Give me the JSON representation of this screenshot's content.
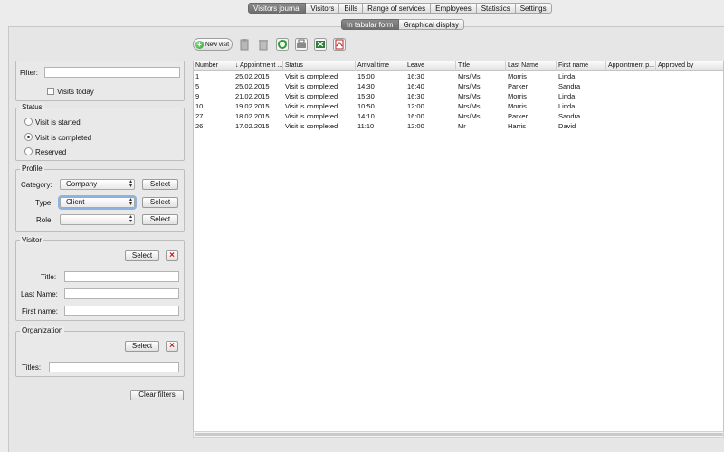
{
  "nav": {
    "tabs": [
      {
        "label": "Visitors journal",
        "active": true
      },
      {
        "label": "Visitors"
      },
      {
        "label": "Bills"
      },
      {
        "label": "Range of services"
      },
      {
        "label": "Employees"
      },
      {
        "label": "Statistics"
      },
      {
        "label": "Settings"
      }
    ]
  },
  "view_tabs": [
    {
      "label": "In tabular form",
      "active": true
    },
    {
      "label": "Graphical display"
    }
  ],
  "toolbar": {
    "new_visit_label": "New visit",
    "icons": [
      "new-visit-icon",
      "clipboard-icon",
      "trash-icon",
      "refresh-icon",
      "print-icon",
      "excel-export-icon",
      "pdf-export-icon"
    ]
  },
  "filter": {
    "label": "Filter:",
    "value": "",
    "visits_today_label": "Visits today",
    "visits_today_checked": false
  },
  "status": {
    "title": "Status",
    "options": [
      "Visit is started",
      "Visit is completed",
      "Reserved"
    ],
    "selected": "Visit is completed"
  },
  "profile": {
    "title": "Profile",
    "category_label": "Category:",
    "category_value": "Company",
    "type_label": "Type:",
    "type_value": "Client",
    "role_label": "Role:",
    "role_value": "",
    "select_label": "Select"
  },
  "visitor": {
    "title": "Visitor",
    "select_label": "Select",
    "title_label": "Title:",
    "last_name_label": "Last Name:",
    "first_name_label": "First name:"
  },
  "organization": {
    "title": "Organization",
    "select_label": "Select",
    "titles_label": "Titles:"
  },
  "clear_filters_label": "Clear filters",
  "table": {
    "columns": [
      "Number",
      "↓ Appointment ...",
      "Status",
      "Arrival time",
      "Leave",
      "Title",
      "Last Name",
      "First name",
      "Appointment p...",
      "Approved by"
    ],
    "rows": [
      [
        "1",
        "25.02.2015",
        "Visit is completed",
        "15:00",
        "16:30",
        "Mrs/Ms",
        "Morris",
        "Linda",
        "",
        ""
      ],
      [
        "5",
        "25.02.2015",
        "Visit is completed",
        "14:30",
        "16:40",
        "Mrs/Ms",
        "Parker",
        "Sandra",
        "",
        ""
      ],
      [
        "9",
        "21.02.2015",
        "Visit is completed",
        "15:30",
        "16:30",
        "Mrs/Ms",
        "Morris",
        "Linda",
        "",
        ""
      ],
      [
        "10",
        "19.02.2015",
        "Visit is completed",
        "10:50",
        "12:00",
        "Mrs/Ms",
        "Morris",
        "Linda",
        "",
        ""
      ],
      [
        "27",
        "18.02.2015",
        "Visit is completed",
        "14:10",
        "16:00",
        "Mrs/Ms",
        "Parker",
        "Sandra",
        "",
        ""
      ],
      [
        "26",
        "17.02.2015",
        "Visit is completed",
        "11:10",
        "12:00",
        "Mr",
        "Harris",
        "David",
        "",
        ""
      ]
    ]
  },
  "colors": {
    "active_tab": "#7a7a7a",
    "delete_red": "#c01a1a",
    "focus_ring": "#8db3e2"
  }
}
